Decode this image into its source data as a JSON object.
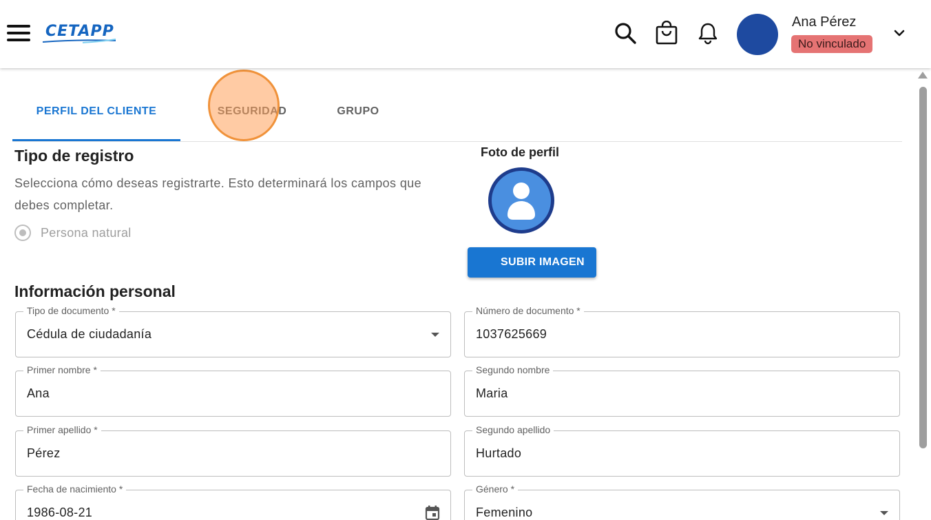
{
  "header": {
    "logo_text": "CETAPP",
    "user_name": "Ana Pérez",
    "status_badge": "No vinculado",
    "icons": [
      "menu-icon",
      "search-icon",
      "shopping-bag-icon",
      "bell-icon",
      "chevron-down-icon"
    ]
  },
  "tabs": [
    {
      "label": "PERFIL DEL CLIENTE",
      "active": true
    },
    {
      "label": "SEGURIDAD",
      "active": false
    },
    {
      "label": "GRUPO",
      "active": false
    }
  ],
  "registration": {
    "title": "Tipo de registro",
    "description": "Selecciona cómo deseas registrarte. Esto determinará los campos que debes completar.",
    "option_label": "Persona natural"
  },
  "profile_photo": {
    "label": "Foto de perfil",
    "upload_button": "SUBIR IMAGEN"
  },
  "personal_info": {
    "title": "Información personal",
    "fields": {
      "tipo_documento": {
        "label": "Tipo de documento *",
        "value": "Cédula de ciudadanía"
      },
      "numero_documento": {
        "label": "Número de documento *",
        "value": "1037625669"
      },
      "primer_nombre": {
        "label": "Primer nombre *",
        "value": "Ana"
      },
      "segundo_nombre": {
        "label": "Segundo nombre",
        "value": "Maria"
      },
      "primer_apellido": {
        "label": "Primer apellido *",
        "value": "Pérez"
      },
      "segundo_apellido": {
        "label": "Segundo apellido",
        "value": "Hurtado"
      },
      "fecha_nacimiento": {
        "label": "Fecha de nacimiento *",
        "value": "1986-08-21"
      },
      "genero": {
        "label": "Género *",
        "value": "Femenino"
      }
    }
  },
  "colors": {
    "primary": "#1976d2",
    "avatar": "#1e4aa0",
    "badge": "#e57373"
  }
}
